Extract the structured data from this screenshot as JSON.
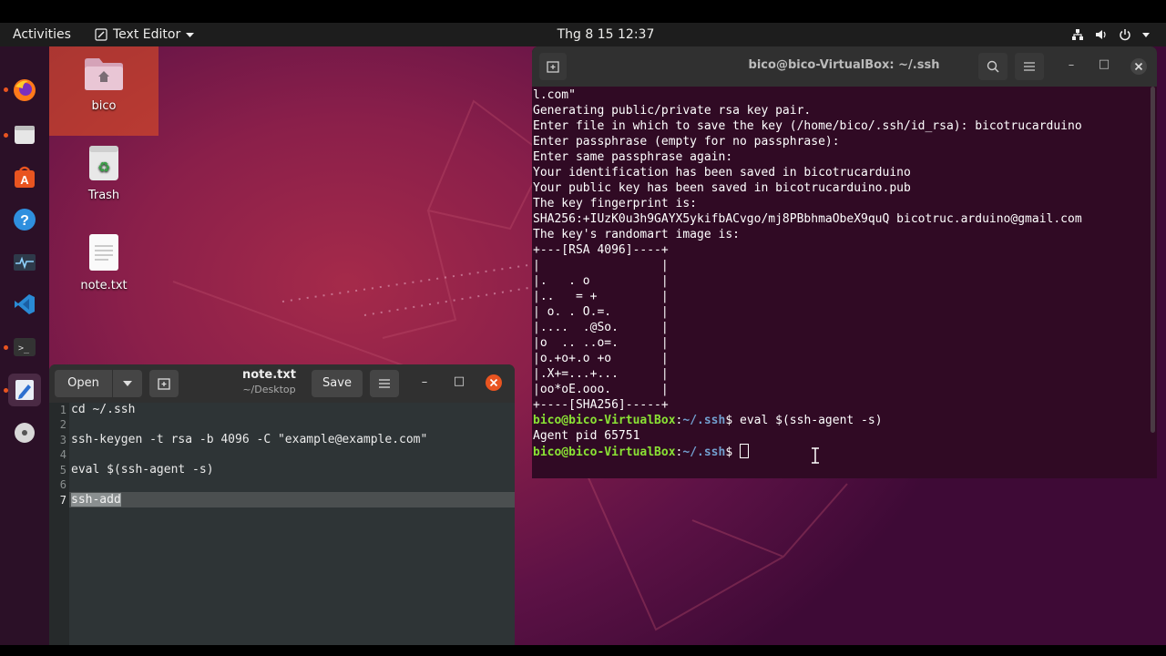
{
  "top_panel": {
    "activities": "Activities",
    "app_menu": "Text Editor",
    "clock": "Thg 8 15  12:37"
  },
  "dock": {
    "items": [
      "firefox-icon",
      "files-icon",
      "software-icon",
      "help-icon",
      "system-monitor-icon",
      "vscode-icon",
      "terminal-icon",
      "text-editor-icon",
      "disc-icon"
    ]
  },
  "desktop": {
    "icons": [
      {
        "label": "bico"
      },
      {
        "label": "Trash"
      },
      {
        "label": "note.txt"
      }
    ]
  },
  "editor": {
    "open_label": "Open",
    "save_label": "Save",
    "title": "note.txt",
    "subtitle": "~/Desktop",
    "line_numbers": [
      "1",
      "2",
      "3",
      "4",
      "5",
      "6",
      "7"
    ],
    "lines": [
      "cd ~/.ssh",
      "",
      "ssh-keygen -t rsa -b 4096 -C \"example@example.com\"",
      "",
      "eval $(ssh-agent -s)",
      "",
      "ssh-add"
    ],
    "current_line": 7
  },
  "terminal": {
    "title": "bico@bico-VirtualBox: ~/.ssh",
    "output": [
      "l.com\"",
      "Generating public/private rsa key pair.",
      "Enter file in which to save the key (/home/bico/.ssh/id_rsa): bicotrucarduino",
      "Enter passphrase (empty for no passphrase):",
      "Enter same passphrase again:",
      "Your identification has been saved in bicotrucarduino",
      "Your public key has been saved in bicotrucarduino.pub",
      "The key fingerprint is:",
      "SHA256:+IUzK0u3h9GAYX5ykifbACvgo/mj8PBbhmaObeX9quQ bicotruc.arduino@gmail.com",
      "The key's randomart image is:",
      "+---[RSA 4096]----+",
      "|                 |",
      "|.   . o          |",
      "|..   = +         |",
      "| o. . O.=.       |",
      "|....  .@So.      |",
      "|o  .. ..o=.      |",
      "|o.+o+.o +o       |",
      "|.X+=...+...      |",
      "|oo*oE.ooo.       |",
      "+----[SHA256]-----+"
    ],
    "prompt_user": "bico@bico-VirtualBox",
    "prompt_sep": ":",
    "prompt_path": "~/.ssh",
    "prompt_dollar": "$ ",
    "command1": "eval $(ssh-agent -s)",
    "agent_output": "Agent pid 65751",
    "command2": ""
  },
  "colors": {
    "ubuntu_orange": "#e95420",
    "terminal_bg": "#300a24",
    "prompt_green": "#8ae234",
    "prompt_blue": "#729fcf"
  }
}
